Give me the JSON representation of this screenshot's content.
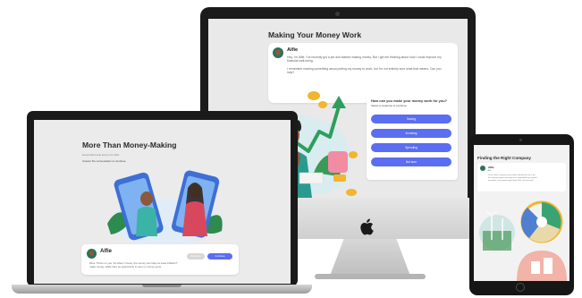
{
  "imac": {
    "title": "Making Your Money Work",
    "message": {
      "name": "Alfie",
      "para1": "Hey, I'm Alfie. I've recently got a job and started making money. But I get me thinking about how I could improve my financial well-being.",
      "para2": "I remember reading something about putting my money to work, but I'm not entirely sure what that means. Can you help?"
    },
    "question": "How can you make your money work for you?",
    "hint": "Select a response to continue.",
    "options": [
      "Saving",
      "Investing",
      "Spending",
      "Not sure"
    ]
  },
  "macbook": {
    "title": "More Than Money-Making",
    "subtitle": "Essentials bank lesson for Alfie",
    "hint": "Answer the conversation to continue.",
    "card": {
      "name": "Alfie",
      "line1": "Wow. That's on you. So when I invest, the money can help me beat inflation?",
      "line2": "make money, while here as opportunity to see my money grow.",
      "prev": "Previous",
      "next": "Continue"
    }
  },
  "ipad": {
    "title": "Finding the Right Company",
    "card": {
      "name": "Alfie",
      "sub": "Alfie",
      "line1": "Ok so I think a company shares values and ideals for the 1 star",
      "line2": "the company through measuring up to sustainability, my research,",
      "line3": "investment, and economic opportunity. What's the next step?"
    }
  },
  "colors": {
    "accent": "#5b6df0",
    "device_bezel": "#1b1b1b",
    "screen_bg": "#e9e9ea"
  }
}
